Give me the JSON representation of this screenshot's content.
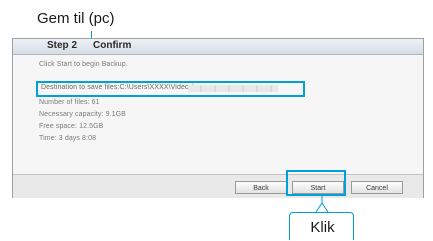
{
  "callouts": {
    "top_label": "Gem til (pc)",
    "bottom_label": "Klik",
    "accent_color": "#00a0d8"
  },
  "dialog": {
    "steps": [
      "Step 2",
      "Confirm"
    ],
    "lines": {
      "intro": "Click Start to begin Backup.",
      "destination": "Destination to save files:C:\\Users\\XXXX\\Videos\\",
      "number_of_files": "Number of files: 61",
      "necessary_capacity": "Necessary capacity: 9.1GB",
      "free_space": "Free space: 12.5GB",
      "time": "Time: 3 days 8:08"
    },
    "buttons": {
      "back": "Back",
      "start": "Start",
      "cancel": "Cancel"
    }
  }
}
